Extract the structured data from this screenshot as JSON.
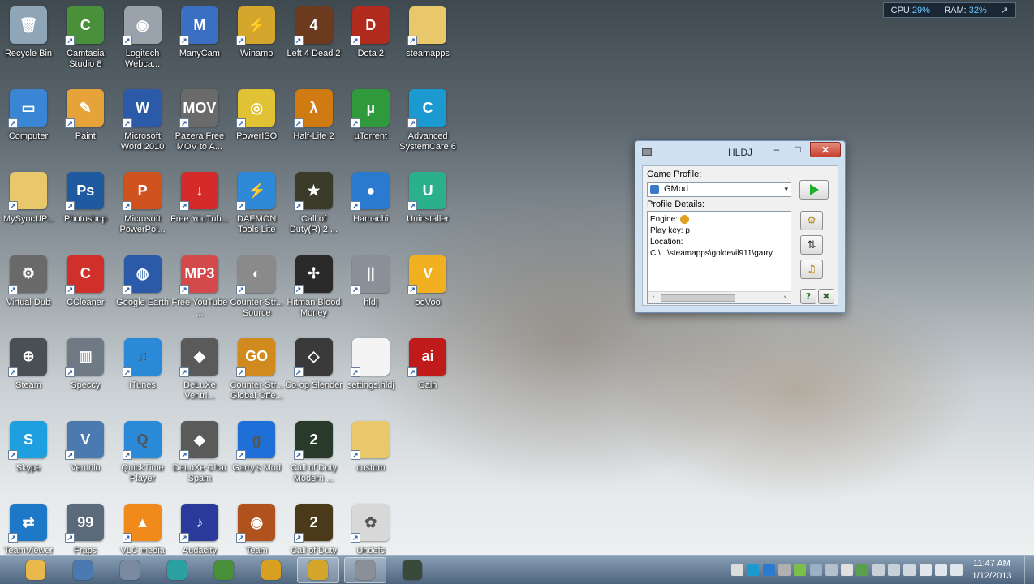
{
  "desktop": {
    "icons": [
      {
        "label": "Recycle Bin",
        "icon": "recycle-bin-icon",
        "color": "#8fa6b8",
        "glyph": "🗑"
      },
      {
        "label": "Camtasia Studio 8",
        "icon": "camtasia-icon",
        "color": "#4a8f3a",
        "glyph": "C"
      },
      {
        "label": "Logitech Webca...",
        "icon": "webcam-icon",
        "color": "#9aa3ab",
        "glyph": "◉"
      },
      {
        "label": "ManyCam",
        "icon": "manycam-icon",
        "color": "#3a6fc4",
        "glyph": "M"
      },
      {
        "label": "Winamp",
        "icon": "winamp-icon",
        "color": "#d4a72c",
        "glyph": "⚡"
      },
      {
        "label": "Left 4 Dead 2",
        "icon": "left4dead-icon",
        "color": "#6b3a1f",
        "glyph": "4"
      },
      {
        "label": "Dota 2",
        "icon": "dota-icon",
        "color": "#b02a1e",
        "glyph": "D"
      },
      {
        "label": "steamapps",
        "icon": "folder-icon",
        "color": "#e8c86a",
        "glyph": ""
      },
      {
        "label": "Computer",
        "icon": "computer-icon",
        "color": "#3a86d4",
        "glyph": "▭"
      },
      {
        "label": "Paint",
        "icon": "paint-icon",
        "color": "#e6a33a",
        "glyph": "✎"
      },
      {
        "label": "Microsoft Word 2010",
        "icon": "word-icon",
        "color": "#2a5aa8",
        "glyph": "W"
      },
      {
        "label": "Pazera Free MOV to A...",
        "icon": "pazera-icon",
        "color": "#6a6a6a",
        "glyph": "MOV"
      },
      {
        "label": "PowerISO",
        "icon": "poweriso-icon",
        "color": "#e0c234",
        "glyph": "◎"
      },
      {
        "label": "Half-Life 2",
        "icon": "halflife-icon",
        "color": "#d07a12",
        "glyph": "λ"
      },
      {
        "label": "µTorrent",
        "icon": "utorrent-icon",
        "color": "#2e9a3c",
        "glyph": "µ"
      },
      {
        "label": "Advanced SystemCare 6",
        "icon": "systemcare-icon",
        "color": "#1a9ad0",
        "glyph": "C"
      },
      {
        "label": "MySyncUP...",
        "icon": "folder-icon",
        "color": "#e8c86a",
        "glyph": ""
      },
      {
        "label": "Photoshop",
        "icon": "photoshop-icon",
        "color": "#1f5aa0",
        "glyph": "Ps"
      },
      {
        "label": "Microsoft PowerPoi...",
        "icon": "powerpoint-icon",
        "color": "#d0521e",
        "glyph": "P"
      },
      {
        "label": "Free YouTub...",
        "icon": "youtube-download-icon",
        "color": "#d42a2a",
        "glyph": "↓"
      },
      {
        "label": "DAEMON Tools Lite",
        "icon": "daemon-tools-icon",
        "color": "#2e8ad8",
        "glyph": "⚡"
      },
      {
        "label": "Call of Duty(R) 2 ...",
        "icon": "callofduty-icon",
        "color": "#3b3b2a",
        "glyph": "★"
      },
      {
        "label": "Hamachi",
        "icon": "hamachi-icon",
        "color": "#2a7ad0",
        "glyph": "●"
      },
      {
        "label": "Uninstaller",
        "icon": "uninstaller-icon",
        "color": "#2ab08a",
        "glyph": "U"
      },
      {
        "label": "Virtual Dub",
        "icon": "gear-icon",
        "color": "#6a6a6a",
        "glyph": "⚙"
      },
      {
        "label": "CCleaner",
        "icon": "ccleaner-icon",
        "color": "#d0302a",
        "glyph": "C"
      },
      {
        "label": "Google Earth",
        "icon": "google-earth-icon",
        "color": "#2a5aa8",
        "glyph": "◍"
      },
      {
        "label": "Free YouTube ...",
        "icon": "youtube-mp3-icon",
        "color": "#d44a4a",
        "glyph": "MP3"
      },
      {
        "label": "Counter-Str... Source",
        "icon": "counterstrike-icon",
        "color": "#8a8a8a",
        "glyph": "◐"
      },
      {
        "label": "Hitman Blood Money",
        "icon": "hitman-icon",
        "color": "#2a2a2a",
        "glyph": "✢"
      },
      {
        "label": "hldj",
        "icon": "hldj-icon",
        "color": "#8a8f98",
        "glyph": "||"
      },
      {
        "label": "ooVoo",
        "icon": "oovoo-icon",
        "color": "#f0b020",
        "glyph": "V"
      },
      {
        "label": "Steam",
        "icon": "steam-icon",
        "color": "#4a4e55",
        "glyph": "⊕"
      },
      {
        "label": "Speccy",
        "icon": "speccy-icon",
        "color": "#707a84",
        "glyph": "▥"
      },
      {
        "label": "iTunes",
        "icon": "itunes-icon",
        "color": "#2a8ad8",
        "glyph": "♫"
      },
      {
        "label": "DeLuXe Ventri...",
        "icon": "deluxe-ventrilo-icon",
        "color": "#5a5a5a",
        "glyph": "◆"
      },
      {
        "label": "Counter-Str... Global Offe...",
        "icon": "csgo-icon",
        "color": "#d08a1e",
        "glyph": "GO"
      },
      {
        "label": "Co-op Slender",
        "icon": "unity-icon",
        "color": "#3a3a3a",
        "glyph": "◇"
      },
      {
        "label": "settings.hldj",
        "icon": "file-icon",
        "color": "#f4f4f4",
        "glyph": ""
      },
      {
        "label": "Cain",
        "icon": "cain-icon",
        "color": "#c01a1a",
        "glyph": "ai"
      },
      {
        "label": "Skype",
        "icon": "skype-icon",
        "color": "#1ea0e0",
        "glyph": "S"
      },
      {
        "label": "Ventrilo",
        "icon": "ventrilo-icon",
        "color": "#4a7ab0",
        "glyph": "V"
      },
      {
        "label": "QuickTime Player",
        "icon": "quicktime-icon",
        "color": "#2a8ad8",
        "glyph": "Q"
      },
      {
        "label": "DeLuXe Chat Spam",
        "icon": "deluxe-chat-icon",
        "color": "#5a5a5a",
        "glyph": "◆"
      },
      {
        "label": "Garry's Mod",
        "icon": "garrysmod-icon",
        "color": "#1e6fd8",
        "glyph": "g"
      },
      {
        "label": "Call of Duty Modern ...",
        "icon": "callofduty-mw-icon",
        "color": "#2a3a2a",
        "glyph": "2"
      },
      {
        "label": "custom",
        "icon": "folder-icon",
        "color": "#e8c86a",
        "glyph": ""
      },
      {
        "label": "TeamViewer",
        "icon": "teamviewer-icon",
        "color": "#1e78c8",
        "glyph": "⇄"
      },
      {
        "label": "Fraps",
        "icon": "fraps-icon",
        "color": "#5a6a7a",
        "glyph": "99"
      },
      {
        "label": "VLC media",
        "icon": "vlc-icon",
        "color": "#f08a1a",
        "glyph": "▲"
      },
      {
        "label": "Audacity",
        "icon": "audacity-icon",
        "color": "#2a3a9a",
        "glyph": "♪"
      },
      {
        "label": "Team",
        "icon": "tf2-icon",
        "color": "#b0521e",
        "glyph": "◉"
      },
      {
        "label": "Call of Duty",
        "icon": "callofduty2-icon",
        "color": "#4a3a1a",
        "glyph": "2"
      },
      {
        "label": "Undefs",
        "icon": "undefs-icon",
        "color": "#d8d8d8",
        "glyph": "✿"
      }
    ]
  },
  "meter": {
    "cpu_label": "CPU:",
    "cpu_value": "29%",
    "ram_label": "RAM:",
    "ram_value": "32%",
    "expand": "↗"
  },
  "hldj_window": {
    "title": "HLDJ",
    "minimize": "–",
    "maximize": "□",
    "close": "✕",
    "game_profile_label": "Game Profile:",
    "game_profile_value": "GMod",
    "dropdown_arrow": "▾",
    "profile_details_label": "Profile Details:",
    "engine_label": "Engine:",
    "play_key_label": "Play key:",
    "play_key_value": "p",
    "location_label": "Location:",
    "location_value": "C:\\...\\steamapps\\goldevil911\\garry",
    "scroll_left": "‹",
    "scroll_right": "›",
    "settings_glyph": "⚙",
    "mixer_glyph": "⇅",
    "music_glyph": "♫",
    "help_glyph": "?",
    "exit_glyph": "✖"
  },
  "taskbar": {
    "apps": [
      {
        "icon": "explorer-icon",
        "color": "#e8b84a",
        "active": false
      },
      {
        "icon": "ventrilo-icon",
        "color": "#4a7ab0",
        "active": false
      },
      {
        "icon": "ventrilo-headset-icon",
        "color": "#7a8aa0",
        "active": false
      },
      {
        "icon": "hamachi-icon",
        "color": "#2aa0a0",
        "active": false
      },
      {
        "icon": "camtasia-icon",
        "color": "#4a8f3a",
        "active": false
      },
      {
        "icon": "chrome-icon",
        "color": "#d8a020",
        "active": false
      },
      {
        "icon": "winamp-icon",
        "color": "#d4a72c",
        "active": true
      },
      {
        "icon": "hldj-icon",
        "color": "#8a8f98",
        "active": true
      },
      {
        "icon": "terminal-icon",
        "color": "#3a4a3a",
        "active": false
      }
    ],
    "tray": [
      {
        "icon": "steam-tray-icon",
        "color": "#dcdcdc"
      },
      {
        "icon": "systemcare-tray-icon",
        "color": "#1a9ad0"
      },
      {
        "icon": "hamachi-tray-icon",
        "color": "#2a7ad0"
      },
      {
        "icon": "usb-tray-icon",
        "color": "#b0b0b0"
      },
      {
        "icon": "battery-tray-icon",
        "color": "#7ac04a"
      },
      {
        "icon": "network-tray-icon",
        "color": "#9ab0c4"
      },
      {
        "icon": "monitor-tray-icon",
        "color": "#b4c0cc"
      },
      {
        "icon": "antivirus-tray-icon",
        "color": "#e0e0e0"
      },
      {
        "icon": "shield-tray-icon",
        "color": "#5aa04a"
      },
      {
        "icon": "flag-tray-icon",
        "color": "#c8d0d8"
      },
      {
        "icon": "display-tray-icon",
        "color": "#c8d0d8"
      },
      {
        "icon": "sync-tray-icon",
        "color": "#d0d8e0"
      },
      {
        "icon": "wifi-tray-icon",
        "color": "#e0e6ec"
      },
      {
        "icon": "power-tray-icon",
        "color": "#e0e6ec"
      },
      {
        "icon": "volume-tray-icon",
        "color": "#e0e6ec"
      }
    ],
    "time": "11:47 AM",
    "date": "1/12/2013"
  }
}
